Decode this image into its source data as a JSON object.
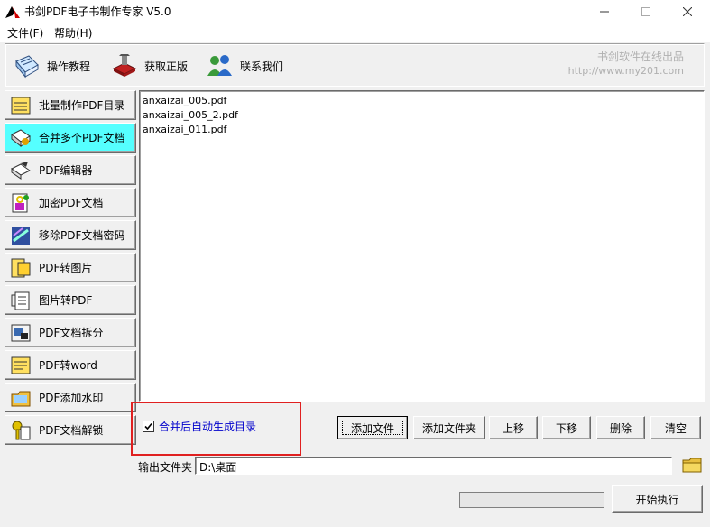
{
  "window": {
    "title": "书剑PDF电子书制作专家 V5.0"
  },
  "menu": {
    "file": "文件(F)",
    "help": "帮助(H)"
  },
  "toolbar": {
    "tutorial": "操作教程",
    "buy": "获取正版",
    "contact": "联系我们",
    "brand_line1": "书剑软件在线出品",
    "brand_line2": "http://www.my201.com"
  },
  "sidebar": {
    "items": [
      {
        "label": "批量制作PDF目录",
        "icon": "notepad-icon"
      },
      {
        "label": "合并多个PDF文档",
        "icon": "merge-documents-icon"
      },
      {
        "label": "PDF编辑器",
        "icon": "edit-hand-icon"
      },
      {
        "label": "加密PDF文档",
        "icon": "encrypt-icon"
      },
      {
        "label": "移除PDF文档密码",
        "icon": "remove-password-icon"
      },
      {
        "label": "PDF转图片",
        "icon": "pdf-to-image-icon"
      },
      {
        "label": "图片转PDF",
        "icon": "image-to-pdf-icon"
      },
      {
        "label": "PDF文档拆分",
        "icon": "split-icon"
      },
      {
        "label": "PDF转word",
        "icon": "pdf-to-word-icon"
      },
      {
        "label": "PDF添加水印",
        "icon": "watermark-icon"
      },
      {
        "label": "PDF文档解锁",
        "icon": "unlock-icon"
      }
    ],
    "active_index": 1
  },
  "file_list": [
    "anxaizai_005.pdf",
    "anxaizai_005_2.pdf",
    "anxaizai_011.pdf"
  ],
  "options": {
    "auto_toc_label": "合并后自动生成目录",
    "auto_toc_checked": true
  },
  "actions": {
    "add_file": "添加文件",
    "add_folder": "添加文件夹",
    "move_up": "上移",
    "move_down": "下移",
    "delete": "删除",
    "clear": "清空",
    "start": "开始执行"
  },
  "output": {
    "label": "输出文件夹",
    "value": "D:\\桌面"
  },
  "progress": {
    "value": 0
  },
  "colors": {
    "active_sidebar": "#55ffff",
    "checkbox_label": "#0000cc",
    "highlight": "#e02020"
  }
}
